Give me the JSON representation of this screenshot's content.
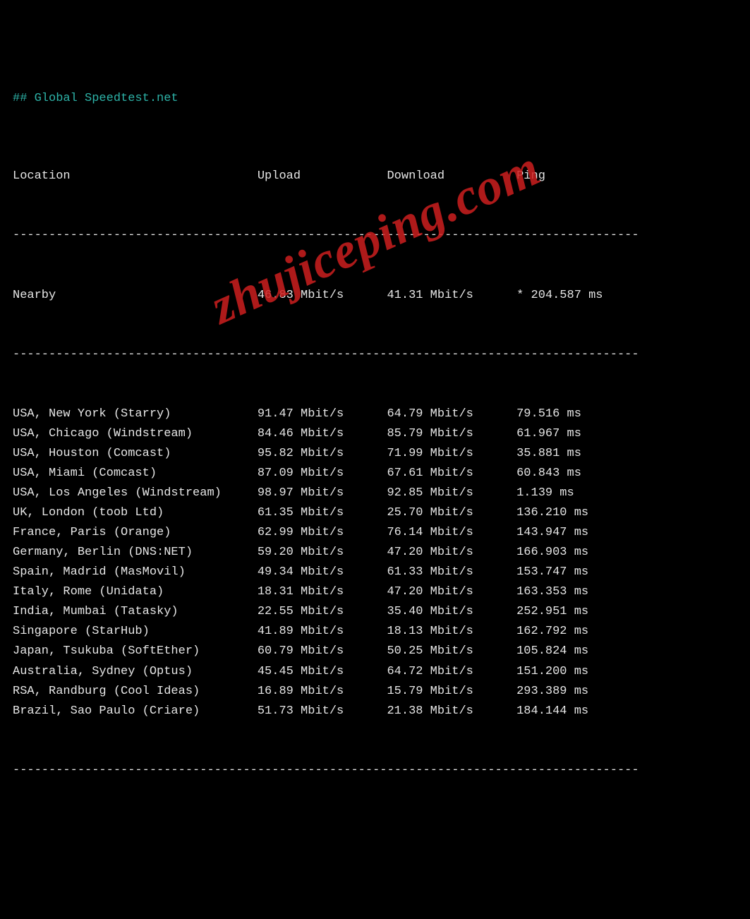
{
  "title": "## Global Speedtest.net",
  "headers": {
    "location": "Location",
    "upload": "Upload",
    "download": "Download",
    "ping": "Ping"
  },
  "nearby": {
    "location": "Nearby",
    "upload": "46.83 Mbit/s",
    "download": "41.31 Mbit/s",
    "ping": "* 204.587 ms"
  },
  "rows": [
    {
      "location": "USA, New York (Starry)",
      "upload": "91.47 Mbit/s",
      "download": "64.79 Mbit/s",
      "ping": "79.516 ms"
    },
    {
      "location": "USA, Chicago (Windstream)",
      "upload": "84.46 Mbit/s",
      "download": "85.79 Mbit/s",
      "ping": "61.967 ms"
    },
    {
      "location": "USA, Houston (Comcast)",
      "upload": "95.82 Mbit/s",
      "download": "71.99 Mbit/s",
      "ping": "35.881 ms"
    },
    {
      "location": "USA, Miami (Comcast)",
      "upload": "87.09 Mbit/s",
      "download": "67.61 Mbit/s",
      "ping": "60.843 ms"
    },
    {
      "location": "USA, Los Angeles (Windstream)",
      "upload": "98.97 Mbit/s",
      "download": "92.85 Mbit/s",
      "ping": "1.139 ms"
    },
    {
      "location": "UK, London (toob Ltd)",
      "upload": "61.35 Mbit/s",
      "download": "25.70 Mbit/s",
      "ping": "136.210 ms"
    },
    {
      "location": "France, Paris (Orange)",
      "upload": "62.99 Mbit/s",
      "download": "76.14 Mbit/s",
      "ping": "143.947 ms"
    },
    {
      "location": "Germany, Berlin (DNS:NET)",
      "upload": "59.20 Mbit/s",
      "download": "47.20 Mbit/s",
      "ping": "166.903 ms"
    },
    {
      "location": "Spain, Madrid (MasMovil)",
      "upload": "49.34 Mbit/s",
      "download": "61.33 Mbit/s",
      "ping": "153.747 ms"
    },
    {
      "location": "Italy, Rome (Unidata)",
      "upload": "18.31 Mbit/s",
      "download": "47.20 Mbit/s",
      "ping": "163.353 ms"
    },
    {
      "location": "India, Mumbai (Tatasky)",
      "upload": "22.55 Mbit/s",
      "download": "35.40 Mbit/s",
      "ping": "252.951 ms"
    },
    {
      "location": "Singapore (StarHub)",
      "upload": "41.89 Mbit/s",
      "download": "18.13 Mbit/s",
      "ping": "162.792 ms"
    },
    {
      "location": "Japan, Tsukuba (SoftEther)",
      "upload": "60.79 Mbit/s",
      "download": "50.25 Mbit/s",
      "ping": "105.824 ms"
    },
    {
      "location": "Australia, Sydney (Optus)",
      "upload": "45.45 Mbit/s",
      "download": "64.72 Mbit/s",
      "ping": "151.200 ms"
    },
    {
      "location": "RSA, Randburg (Cool Ideas)",
      "upload": "16.89 Mbit/s",
      "download": "15.79 Mbit/s",
      "ping": "293.389 ms"
    },
    {
      "location": "Brazil, Sao Paulo (Criare)",
      "upload": "51.73 Mbit/s",
      "download": "21.38 Mbit/s",
      "ping": "184.144 ms"
    }
  ],
  "divider": "---------------------------------------------------------------------------------------",
  "watermark": "zhujiceping.com"
}
